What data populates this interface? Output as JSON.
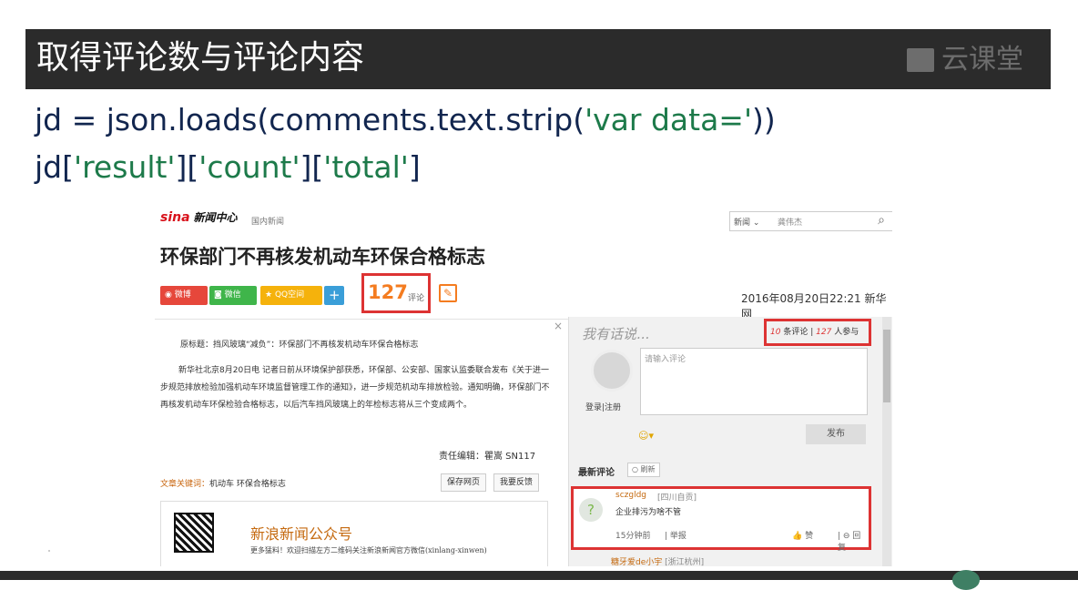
{
  "slide": {
    "title": "取得评论数与评论内容",
    "logo_text": "云课堂",
    "code_line1_a": "jd = json.loads(comments.text.strip(",
    "code_line1_b": "'var data='",
    "code_line1_c": "))",
    "code_line2_a": "jd[",
    "code_line2_b": "'result'",
    "code_line2_c": "][",
    "code_line2_d": "'count'",
    "code_line2_e": "][",
    "code_line2_f": "'total'",
    "code_line2_g": "]"
  },
  "page": {
    "brand": "sina",
    "brand_sub": "新闻中心",
    "channel": "国内新闻",
    "search_select": "新闻",
    "search_value": "龚伟杰",
    "headline": "环保部门不再核发机动车环保合格标志",
    "share": [
      "微博",
      "微信",
      "QQ空间",
      "+"
    ],
    "comment_count": "127",
    "comment_count_label": "评论",
    "date_source": "2016年08月20日22:21 新华网",
    "para1": "原标题：挡风玻璃“减负”：环保部门不再核发机动车环保合格标志",
    "para2": "新华社北京8月20日电 记者日前从环境保护部获悉，环保部、公安部、国家认监委联合发布《关于进一步规范排放检验加强机动车环境监督管理工作的通知》，进一步规范机动车排放检验。通知明确，环保部门不再核发机动车环保检验合格标志，以后汽车挡风玻璃上的年检标志将从三个变成两个。",
    "editor": "责任编辑：瞿嵩 SN117",
    "keywords_label": "文章关键词：",
    "keywords": "机动车 环保合格标志",
    "save_btn": "保存网页",
    "feedback_btn": "我要反馈",
    "promo_title": "新浪新闻公众号",
    "promo_desc": "更多猛料！欢迎扫描左方二维码关注新浪新闻官方微信(xinlang-xinwen)"
  },
  "comment_panel": {
    "close": "×",
    "hint": "我有话说...",
    "stats_count": "10",
    "stats_count_label": "条评论",
    "stats_sep": "|",
    "stats_people": "127",
    "stats_people_label": "人参与",
    "login": "登录|注册",
    "input_placeholder": "请输入评论",
    "emoji": "☺▾",
    "post_btn": "发布",
    "latest_label": "最新评论",
    "refresh_btn": "○ 刷新",
    "comment": {
      "user": "sczgldg",
      "location": "[四川自贡]",
      "text": "企业排污为啥不管",
      "time": "15分钟前",
      "report": "| 举报",
      "like": "👍 赞",
      "reply": "| ⊖ 回复"
    },
    "next_user": "糖牙爱de小宇",
    "next_location": "[浙江杭州]"
  }
}
